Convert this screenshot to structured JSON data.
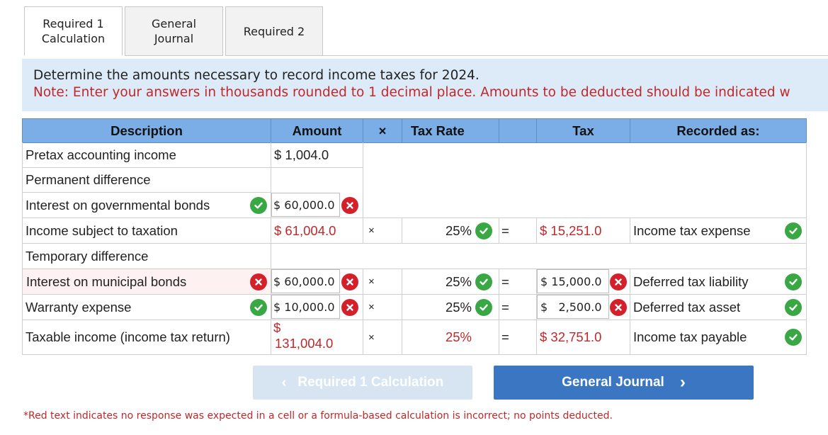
{
  "tabs": [
    {
      "label_line1": "Required 1",
      "label_line2": "Calculation",
      "active": true
    },
    {
      "label_line1": "General",
      "label_line2": "Journal",
      "active": false
    },
    {
      "label_line1": "Required 2",
      "label_line2": "",
      "active": false
    }
  ],
  "instructions": {
    "question": "Determine the amounts necessary to record income taxes for 2024.",
    "note": "Note: Enter your answers in thousands rounded to 1 decimal place. Amounts to be deducted should be indicated w"
  },
  "table": {
    "headers": {
      "description": "Description",
      "amount": "Amount",
      "times": "×",
      "tax_rate": "Tax Rate",
      "blank": "",
      "tax": "Tax",
      "recorded_as": "Recorded as:"
    },
    "rows": {
      "pretax": {
        "description": "Pretax accounting income",
        "amount": "$  1,004.0"
      },
      "permanent": {
        "description": "Permanent difference"
      },
      "interest_gov": {
        "description": "Interest on governmental bonds",
        "amount": "$ 60,000.0",
        "desc_status": "correct",
        "amount_status": "incorrect"
      },
      "subject": {
        "description": "Income subject to taxation",
        "amount": "$ 61,004.0",
        "times": "×",
        "rate": "25%",
        "rate_status": "correct",
        "equals": "=",
        "tax": "$ 15,251.0",
        "recorded": "Income tax expense",
        "recorded_status": "correct"
      },
      "temporary": {
        "description": "Temporary difference"
      },
      "interest_muni": {
        "description": "Interest on municipal bonds",
        "amount": "$ 60,000.0",
        "desc_status": "incorrect",
        "amount_status": "incorrect",
        "times": "×",
        "rate": "25%",
        "rate_status": "correct",
        "equals": "=",
        "tax": "$ 15,000.0",
        "tax_status": "incorrect",
        "recorded": "Deferred tax liability",
        "recorded_status": "correct"
      },
      "warranty": {
        "description": "Warranty expense",
        "amount": "$ 10,000.0",
        "desc_status": "correct",
        "amount_status": "incorrect",
        "times": "×",
        "rate": "25%",
        "rate_status": "correct",
        "equals": "=",
        "tax": "$   2,500.0",
        "tax_status": "incorrect",
        "recorded": "Deferred tax asset",
        "recorded_status": "correct"
      },
      "taxable": {
        "description": "Taxable income (income tax return)",
        "amount_symbol": "$",
        "amount": "131,004.0",
        "times": "×",
        "rate": "25%",
        "equals": "=",
        "tax": "$ 32,751.0",
        "recorded": "Income tax payable",
        "recorded_status": "correct"
      }
    }
  },
  "buttons": {
    "prev_label": "Required 1 Calculation",
    "next_label": "General Journal"
  },
  "footnote": "*Red text indicates no response was expected in a cell or a formula-based calculation is incorrect; no points deducted.",
  "colors": {
    "header_bg": "#7baee6",
    "correct": "#3aa745",
    "incorrect": "#d3202b",
    "red_text": "#c0282b",
    "primary_button": "#3a76c2"
  }
}
